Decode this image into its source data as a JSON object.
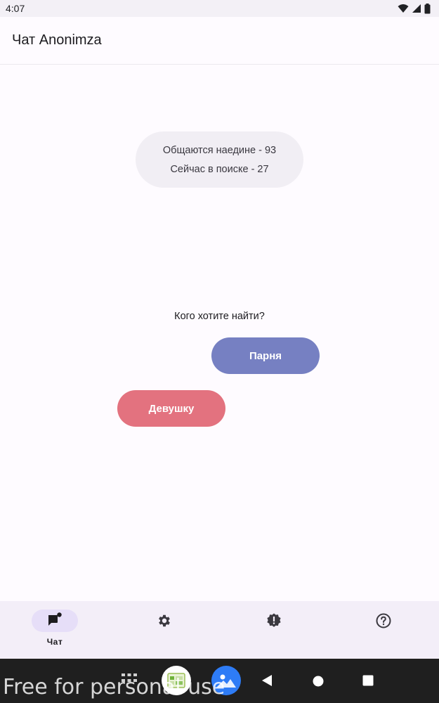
{
  "status_bar": {
    "time": "4:07"
  },
  "app_bar": {
    "title": "Чат Anonimza"
  },
  "stats": {
    "chatting": "Общаются наедине - 93",
    "searching": "Сейчас в поиске - 27"
  },
  "question": "Кого хотите найти?",
  "buttons": {
    "boy": "Парня",
    "girl": "Девушку"
  },
  "bottom_nav": {
    "items": [
      {
        "label": "Чат",
        "icon": "chat-flag-icon",
        "active": true
      },
      {
        "label": "",
        "icon": "settings-gear-icon"
      },
      {
        "label": "",
        "icon": "alert-badge-icon"
      },
      {
        "label": "",
        "icon": "help-circle-icon"
      }
    ]
  },
  "watermark": "Free for personal use",
  "colors": {
    "boy_button": "#7680c2",
    "girl_button": "#e3727f",
    "bubble": "#f1eef4",
    "nav_active": "#e6def8"
  }
}
